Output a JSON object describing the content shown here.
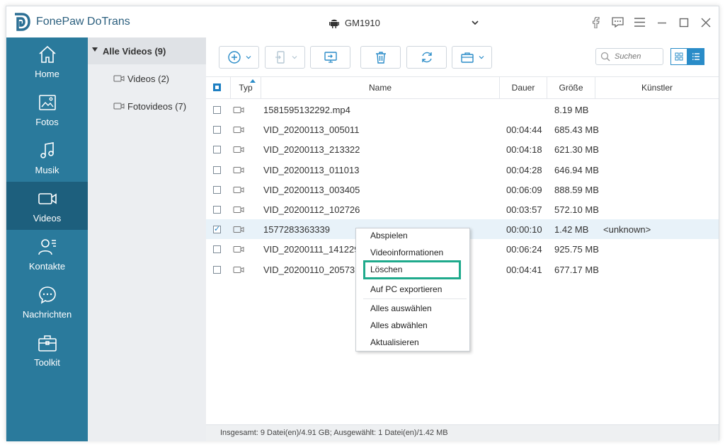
{
  "app": {
    "title": "FonePaw DoTrans"
  },
  "device": {
    "name": "GM1910"
  },
  "sidebar": {
    "items": [
      {
        "label": "Home",
        "icon": "home-icon"
      },
      {
        "label": "Fotos",
        "icon": "photo-icon"
      },
      {
        "label": "Musik",
        "icon": "music-icon"
      },
      {
        "label": "Videos",
        "icon": "video-icon",
        "active": true
      },
      {
        "label": "Kontakte",
        "icon": "contacts-icon"
      },
      {
        "label": "Nachrichten",
        "icon": "messages-icon"
      },
      {
        "label": "Toolkit",
        "icon": "toolkit-icon"
      }
    ]
  },
  "tree": {
    "root": "Alle Videos (9)",
    "children": [
      "Videos (2)",
      "Fotovideos (7)"
    ]
  },
  "search": {
    "placeholder": "Suchen"
  },
  "table": {
    "headers": {
      "type": "Typ",
      "name": "Name",
      "duration": "Dauer",
      "size": "Größe",
      "artist": "Künstler"
    },
    "rows": [
      {
        "name": "1581595132292.mp4",
        "duration": "",
        "size": "8.19 MB",
        "artist": "",
        "checked": false
      },
      {
        "name": "VID_20200113_005011",
        "duration": "00:04:44",
        "size": "685.43 MB",
        "artist": "",
        "checked": false
      },
      {
        "name": "VID_20200113_213322",
        "duration": "00:04:18",
        "size": "621.30 MB",
        "artist": "",
        "checked": false
      },
      {
        "name": "VID_20200113_011013",
        "duration": "00:04:28",
        "size": "646.94 MB",
        "artist": "",
        "checked": false
      },
      {
        "name": "VID_20200113_003405",
        "duration": "00:06:09",
        "size": "888.59 MB",
        "artist": "",
        "checked": false
      },
      {
        "name": "VID_20200112_102726",
        "duration": "00:03:57",
        "size": "572.10 MB",
        "artist": "",
        "checked": false
      },
      {
        "name": "1577283363339",
        "duration": "00:00:10",
        "size": "1.42 MB",
        "artist": "<unknown>",
        "checked": true
      },
      {
        "name": "VID_20200111_141229",
        "duration": "00:06:24",
        "size": "925.75 MB",
        "artist": "",
        "checked": false
      },
      {
        "name": "VID_20200110_205731",
        "duration": "00:04:41",
        "size": "677.17 MB",
        "artist": "",
        "checked": false
      }
    ]
  },
  "context_menu": {
    "items": [
      "Abspielen",
      "Videoinformationen",
      "Löschen",
      "Auf PC exportieren",
      "Alles auswählen",
      "Alles abwählen",
      "Aktualisieren"
    ],
    "highlighted": "Löschen"
  },
  "status": {
    "text": "Insgesamt: 9 Datei(en)/4.91 GB; Ausgewählt: 1 Datei(en)/1.42 MB"
  },
  "colors": {
    "sidebar": "#2a7a9c",
    "sidebar_active": "#1d5f7d",
    "accent": "#2a8cc8",
    "highlight_box": "#1faa8c"
  }
}
